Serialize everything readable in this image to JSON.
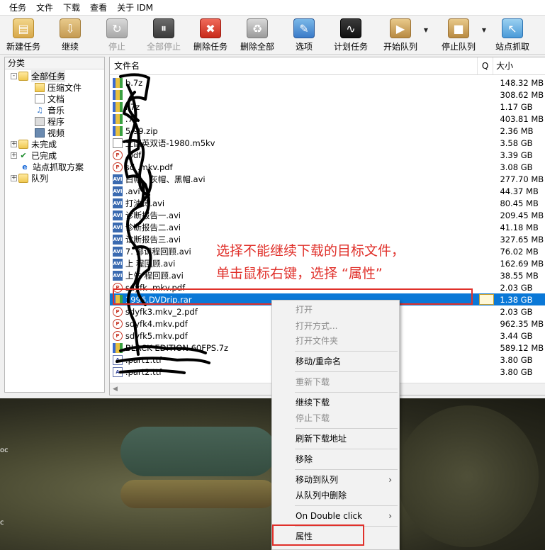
{
  "menubar": [
    "任务",
    "文件",
    "下载",
    "查看",
    "关于 IDM"
  ],
  "toolbar": [
    {
      "label": "新建任务",
      "icon": "new-task-icon",
      "disabled": false
    },
    {
      "label": "继续",
      "icon": "resume-icon",
      "disabled": false
    },
    {
      "label": "停止",
      "icon": "stop-icon",
      "disabled": true
    },
    {
      "label": "全部停止",
      "icon": "stop-all-icon",
      "disabled": true
    },
    {
      "label": "删除任务",
      "icon": "delete-task-icon",
      "disabled": false
    },
    {
      "label": "删除全部",
      "icon": "delete-all-icon",
      "disabled": false
    },
    {
      "label": "选项",
      "icon": "options-icon",
      "disabled": false
    },
    {
      "label": "计划任务",
      "icon": "scheduler-icon",
      "disabled": false
    },
    {
      "label": "开始队列",
      "icon": "start-queue-icon",
      "disabled": false
    },
    {
      "label": "停止队列",
      "icon": "stop-queue-icon",
      "disabled": false
    },
    {
      "label": "站点抓取",
      "icon": "site-grabber-icon",
      "disabled": false
    }
  ],
  "categories": {
    "header": "分类",
    "tree": [
      {
        "label": "全部任务",
        "icon": "folder-open-icon",
        "level": 1,
        "expander": "-"
      },
      {
        "label": "压缩文件",
        "icon": "zip-folder-icon",
        "level": 2
      },
      {
        "label": "文档",
        "icon": "document-icon",
        "level": 2
      },
      {
        "label": "音乐",
        "icon": "music-note-icon",
        "level": 2
      },
      {
        "label": "程序",
        "icon": "program-icon",
        "level": 2
      },
      {
        "label": "视频",
        "icon": "video-icon",
        "level": 2
      },
      {
        "label": "未完成",
        "icon": "unfinished-folder-icon",
        "level": 1,
        "expander": "+"
      },
      {
        "label": "已完成",
        "icon": "finished-check-icon",
        "level": 1,
        "expander": "+"
      },
      {
        "label": "站点抓取方案",
        "icon": "ie-icon",
        "level": 1
      },
      {
        "label": "队列",
        "icon": "queue-folder-icon",
        "level": 1,
        "expander": "+"
      }
    ]
  },
  "file_list": {
    "headers": {
      "name": "文件名",
      "q": "Q",
      "size": "大小"
    },
    "rows": [
      {
        "name": "b.7z",
        "type": "zip",
        "size": "148.32 MB"
      },
      {
        "name": "",
        "type": "zip",
        "size": "308.62 MB"
      },
      {
        "name": "l.7z",
        "type": "zip",
        "size": "1.17 GB"
      },
      {
        "name": ".7z",
        "type": "zip",
        "size": "403.81 MB"
      },
      {
        "name": "5.99.zip",
        "type": "zip",
        "size": "2.36 MB"
      },
      {
        "name": "王国英双语-1980.m5kv",
        "type": "blank",
        "size": "3.58 GB"
      },
      {
        "name": ".pdf",
        "type": "pdf",
        "size": "3.39 GB"
      },
      {
        "name": "sd .mkv.pdf",
        "type": "pdf",
        "size": "3.08 GB"
      },
      {
        "name": "白帽、灰帽、黑帽.avi",
        "type": "avi",
        "size": "277.70 MB"
      },
      {
        "name": ".avi",
        "type": "avi",
        "size": "44.37 MB"
      },
      {
        "name": "打油诗.avi",
        "type": "avi",
        "size": "80.45 MB"
      },
      {
        "name": "诊断报告一.avi",
        "type": "avi",
        "size": "209.45 MB"
      },
      {
        "name": "诊断报告二.avi",
        "type": "avi",
        "size": "41.18 MB"
      },
      {
        "name": "诊断报告三.avi",
        "type": "avi",
        "size": "327.65 MB"
      },
      {
        "name": "7. 部课程回顾.avi",
        "type": "avi",
        "size": "76.02 MB"
      },
      {
        "name": "上 程回顾.avi",
        "type": "avi",
        "size": "162.69 MB"
      },
      {
        "name": "上午 程回顾.avi",
        "type": "avi",
        "size": "38.55 MB"
      },
      {
        "name": "sdyfk .mkv.pdf",
        "type": "pdf",
        "size": "2.03 GB"
      },
      {
        "name": "1996.DVDrip.rar",
        "type": "zip",
        "size": "1.38 GB",
        "selected": true
      },
      {
        "name": "sdyfk3.mkv_2.pdf",
        "type": "pdf",
        "size": "2.03 GB"
      },
      {
        "name": "sdyfk4.mkv.pdf",
        "type": "pdf",
        "size": "962.35 MB"
      },
      {
        "name": "sdyfk5.mkv.pdf",
        "type": "pdf",
        "size": "3.44 GB"
      },
      {
        "name": "BLACK EDITION 60FPS.7z",
        "type": "zip",
        "size": "589.12 MB"
      },
      {
        "name": ".part1.ttf",
        "type": "ttf",
        "size": "3.80 GB"
      },
      {
        "name": ".part2.ttf",
        "type": "ttf",
        "size": "3.80 GB"
      }
    ]
  },
  "annotation": {
    "line1": "选择不能继续下载的目标文件，",
    "line2": "单击鼠标右键，选择 “属性”",
    "color": "#e0302a"
  },
  "context_menu": {
    "items": [
      {
        "label": "打开",
        "disabled": true
      },
      {
        "label": "打开方式...",
        "disabled": true
      },
      {
        "label": "打开文件夹",
        "disabled": true
      },
      {
        "label": "移动/重命名",
        "disabled": false
      },
      {
        "label": "重新下载",
        "disabled": true
      },
      {
        "label": "继续下载",
        "disabled": false
      },
      {
        "label": "停止下载",
        "disabled": true
      },
      {
        "label": "刷新下载地址",
        "disabled": false
      },
      {
        "label": "移除",
        "disabled": false
      },
      {
        "label": "移动到队列",
        "disabled": false,
        "submenu": true
      },
      {
        "label": "从队列中删除",
        "disabled": false
      },
      {
        "label": "On Double click",
        "disabled": false,
        "submenu": true
      },
      {
        "label": "属性",
        "disabled": false
      }
    ]
  },
  "edge_text": {
    "a": "oc",
    "b": "c"
  },
  "colors": {
    "selection": "#0a78d7",
    "annotation": "#e0302a"
  }
}
